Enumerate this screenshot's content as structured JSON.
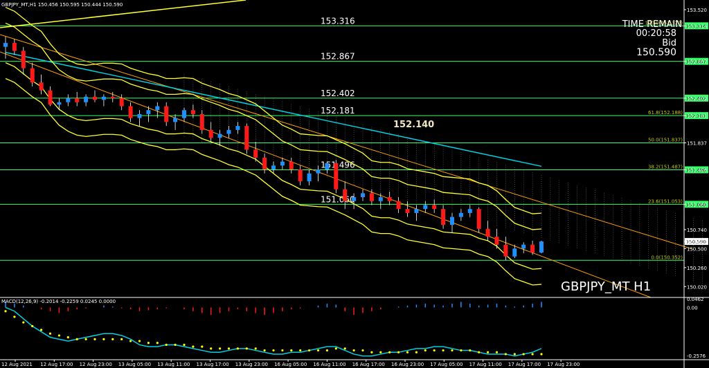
{
  "header": "GBPJPY_MT,H1  150.456 150.595 150.444 150.590",
  "symbol_label": "GBPJPY_MT H1",
  "timer": {
    "title": "TIME REMAIN",
    "value": "00:20:58",
    "price_type": "Bid",
    "price": "150.590"
  },
  "macd_header": "MACD(12,26,9) -0.2014 -0.2259 0.0245 0.0000",
  "colors": {
    "bull": "#1e90ff",
    "bear": "#ff1a1a",
    "band": "#ffff33",
    "cloud": "#ffffff",
    "ma": "#00d0e0",
    "level": "#33ff66",
    "channel": "#ffa000",
    "signal": "#ffff00"
  },
  "chart_data": {
    "type": "candlestick",
    "ylim": [
      149.9,
      153.52
    ],
    "y_ticks": [
      "153.520",
      "153.314",
      "152.867",
      "152.402",
      "152.181",
      "151.837",
      "151.496",
      "151.060",
      "150.740",
      "150.590",
      "150.500",
      "150.260",
      "150.020"
    ],
    "x_ticks": [
      "12 Aug 2021",
      "12 Aug 17:00",
      "12 Aug 23:00",
      "13 Aug 05:00",
      "13 Aug 11:00",
      "13 Aug 17:00",
      "13 Aug 23:00",
      "16 Aug 05:00",
      "16 Aug 11:00",
      "16 Aug 17:00",
      "16 Aug 23:00",
      "17 Aug 05:00",
      "17 Aug 11:00",
      "17 Aug 17:00",
      "17 Aug 23:00"
    ],
    "levels": [
      {
        "price": 153.316,
        "label": "153.316",
        "tag": "153.314",
        "fibo": "100.0(153.322)"
      },
      {
        "price": 152.867,
        "label": "152.867",
        "tag": "152.867",
        "fibo": ""
      },
      {
        "price": 152.402,
        "label": "152.402",
        "tag": "152.402",
        "fibo": ""
      },
      {
        "price": 152.181,
        "label": "152.181",
        "tag": "152.181",
        "fibo": "61.8(152.188)"
      },
      {
        "price": 151.837,
        "label": "",
        "tag": "",
        "fibo": "50.0(151.837)"
      },
      {
        "price": 151.496,
        "label": "151.496",
        "tag": "151.496",
        "fibo": "38.2(151.487)"
      },
      {
        "price": 151.06,
        "label": "151.060",
        "tag": "151.060",
        "fibo": "23.6(151.053)"
      },
      {
        "price": 150.352,
        "label": "",
        "tag": "",
        "fibo": "0.0(150.352)"
      }
    ],
    "annotation": {
      "text": "152.140",
      "price": 152.14
    },
    "current_price": 150.59,
    "candles": [
      [
        153.05,
        153.18,
        152.9,
        153.1
      ],
      [
        153.1,
        153.15,
        152.95,
        153.0
      ],
      [
        153.0,
        153.05,
        152.7,
        152.78
      ],
      [
        152.78,
        152.85,
        152.55,
        152.6
      ],
      [
        152.6,
        152.7,
        152.45,
        152.5
      ],
      [
        152.5,
        152.55,
        152.3,
        152.32
      ],
      [
        152.32,
        152.4,
        152.25,
        152.35
      ],
      [
        152.35,
        152.45,
        152.3,
        152.4
      ],
      [
        152.4,
        152.48,
        152.3,
        152.35
      ],
      [
        152.35,
        152.45,
        152.3,
        152.42
      ],
      [
        152.42,
        152.5,
        152.35,
        152.38
      ],
      [
        152.38,
        152.45,
        152.3,
        152.42
      ],
      [
        152.42,
        152.48,
        152.35,
        152.4
      ],
      [
        152.4,
        152.45,
        152.25,
        152.3
      ],
      [
        152.3,
        152.35,
        152.1,
        152.15
      ],
      [
        152.15,
        152.25,
        152.05,
        152.2
      ],
      [
        152.2,
        152.3,
        152.1,
        152.25
      ],
      [
        152.25,
        152.35,
        152.15,
        152.3
      ],
      [
        152.3,
        152.35,
        152.05,
        152.1
      ],
      [
        152.1,
        152.2,
        152.0,
        152.15
      ],
      [
        152.15,
        152.28,
        152.1,
        152.25
      ],
      [
        152.25,
        152.32,
        152.15,
        152.2
      ],
      [
        152.2,
        152.25,
        151.95,
        152.0
      ],
      [
        152.0,
        152.1,
        151.85,
        151.9
      ],
      [
        151.9,
        152.0,
        151.8,
        151.95
      ],
      [
        151.95,
        152.05,
        151.9,
        152.0
      ],
      [
        152.0,
        152.1,
        151.95,
        152.05
      ],
      [
        152.05,
        152.08,
        151.7,
        151.75
      ],
      [
        151.75,
        151.85,
        151.6,
        151.65
      ],
      [
        151.65,
        151.7,
        151.45,
        151.5
      ],
      [
        151.5,
        151.6,
        151.45,
        151.55
      ],
      [
        151.55,
        151.65,
        151.5,
        151.6
      ],
      [
        151.6,
        151.65,
        151.45,
        151.5
      ],
      [
        151.5,
        151.55,
        151.3,
        151.35
      ],
      [
        151.35,
        151.5,
        151.3,
        151.45
      ],
      [
        151.45,
        151.55,
        151.35,
        151.5
      ],
      [
        151.5,
        151.6,
        151.45,
        151.58
      ],
      [
        151.58,
        151.62,
        151.2,
        151.25
      ],
      [
        151.25,
        151.35,
        151.0,
        151.1
      ],
      [
        151.1,
        151.2,
        151.0,
        151.15
      ],
      [
        151.15,
        151.25,
        151.1,
        151.2
      ],
      [
        151.2,
        151.25,
        151.05,
        151.1
      ],
      [
        151.1,
        151.2,
        151.0,
        151.15
      ],
      [
        151.15,
        151.22,
        151.05,
        151.1
      ],
      [
        151.1,
        151.15,
        150.95,
        151.0
      ],
      [
        151.0,
        151.1,
        150.9,
        150.95
      ],
      [
        150.95,
        151.05,
        150.85,
        151.0
      ],
      [
        151.0,
        151.1,
        150.95,
        151.05
      ],
      [
        151.05,
        151.12,
        150.95,
        151.0
      ],
      [
        151.0,
        151.05,
        150.75,
        150.8
      ],
      [
        150.8,
        150.95,
        150.7,
        150.9
      ],
      [
        150.9,
        151.0,
        150.85,
        150.95
      ],
      [
        150.95,
        151.05,
        150.9,
        151.0
      ],
      [
        151.0,
        151.02,
        150.7,
        150.75
      ],
      [
        150.75,
        150.85,
        150.6,
        150.65
      ],
      [
        150.65,
        150.75,
        150.5,
        150.55
      ],
      [
        150.55,
        150.65,
        150.35,
        150.4
      ],
      [
        150.4,
        150.55,
        150.38,
        150.5
      ],
      [
        150.5,
        150.58,
        150.44,
        150.55
      ],
      [
        150.55,
        150.6,
        150.42,
        150.45
      ],
      [
        150.45,
        150.6,
        150.44,
        150.59
      ]
    ],
    "macd": {
      "ylim": [
        -0.2576,
        0.0462
      ],
      "y_ticks": [
        "0.0462",
        "0.00",
        "-0.2576"
      ],
      "histogram": [
        0.03,
        0.02,
        0.01,
        0.0,
        -0.01,
        -0.02,
        -0.03,
        -0.02,
        -0.01,
        -0.005,
        0.0,
        0.01,
        0.005,
        -0.005,
        -0.01,
        -0.02,
        -0.015,
        -0.01,
        -0.005,
        0.0,
        -0.01,
        -0.02,
        -0.03,
        -0.04,
        -0.03,
        -0.02,
        -0.01,
        -0.02,
        -0.03,
        -0.04,
        -0.03,
        -0.02,
        -0.01,
        -0.005,
        0.0,
        0.01,
        0.02,
        0.015,
        -0.02,
        -0.04,
        -0.03,
        -0.02,
        -0.01,
        0.0,
        0.005,
        0.01,
        0.015,
        0.02,
        0.015,
        0.01,
        0.02,
        0.03,
        0.02,
        0.01,
        0.015,
        0.02,
        0.01,
        0.005,
        0.01,
        0.02,
        0.03
      ],
      "macd_line": [
        0.0,
        -0.02,
        -0.06,
        -0.1,
        -0.13,
        -0.16,
        -0.17,
        -0.18,
        -0.17,
        -0.16,
        -0.15,
        -0.14,
        -0.14,
        -0.15,
        -0.17,
        -0.2,
        -0.21,
        -0.21,
        -0.2,
        -0.2,
        -0.21,
        -0.22,
        -0.23,
        -0.24,
        -0.24,
        -0.23,
        -0.22,
        -0.22,
        -0.23,
        -0.24,
        -0.25,
        -0.25,
        -0.24,
        -0.24,
        -0.23,
        -0.22,
        -0.21,
        -0.21,
        -0.23,
        -0.25,
        -0.26,
        -0.26,
        -0.25,
        -0.24,
        -0.24,
        -0.23,
        -0.22,
        -0.22,
        -0.21,
        -0.21,
        -0.22,
        -0.23,
        -0.23,
        -0.24,
        -0.25,
        -0.25,
        -0.25,
        -0.26,
        -0.25,
        -0.24,
        -0.22
      ],
      "signal_line": [
        -0.02,
        -0.05,
        -0.08,
        -0.1,
        -0.12,
        -0.14,
        -0.15,
        -0.16,
        -0.17,
        -0.17,
        -0.17,
        -0.17,
        -0.17,
        -0.17,
        -0.18,
        -0.18,
        -0.19,
        -0.19,
        -0.2,
        -0.2,
        -0.2,
        -0.21,
        -0.21,
        -0.22,
        -0.22,
        -0.22,
        -0.22,
        -0.22,
        -0.22,
        -0.23,
        -0.23,
        -0.23,
        -0.23,
        -0.23,
        -0.23,
        -0.23,
        -0.23,
        -0.22,
        -0.22,
        -0.23,
        -0.23,
        -0.24,
        -0.24,
        -0.24,
        -0.24,
        -0.24,
        -0.24,
        -0.23,
        -0.23,
        -0.23,
        -0.23,
        -0.23,
        -0.23,
        -0.24,
        -0.24,
        -0.24,
        -0.25,
        -0.25,
        -0.25,
        -0.25,
        -0.25
      ]
    }
  }
}
